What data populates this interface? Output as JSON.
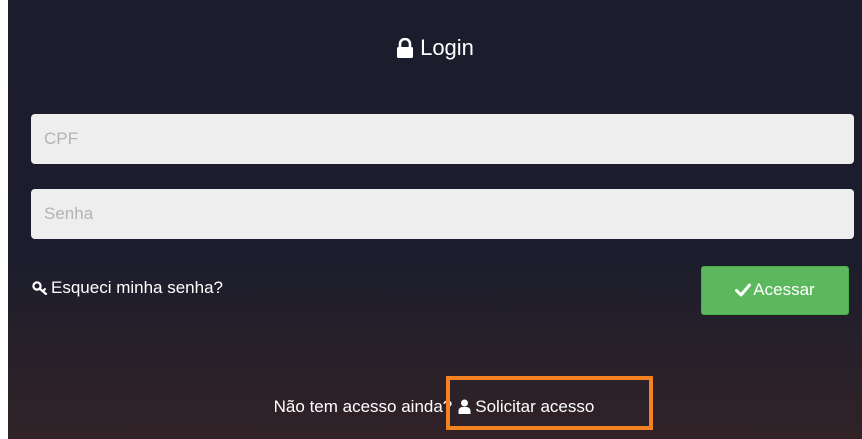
{
  "header": {
    "icon": "lock-icon",
    "title": "Login"
  },
  "form": {
    "cpf_placeholder": "CPF",
    "password_placeholder": "Senha",
    "forgot_icon": "key-icon",
    "forgot_label": "Esqueci minha senha?",
    "submit_icon": "check-icon",
    "submit_label": "Acessar"
  },
  "footer": {
    "question": "Não tem acesso ainda?",
    "request_icon": "user-icon",
    "request_label": "Solicitar acesso"
  },
  "colors": {
    "panel_bg": "#1c1d2c",
    "submit_bg": "#5cb85c",
    "highlight_border": "#f58220",
    "field_bg": "#eeeeee"
  }
}
